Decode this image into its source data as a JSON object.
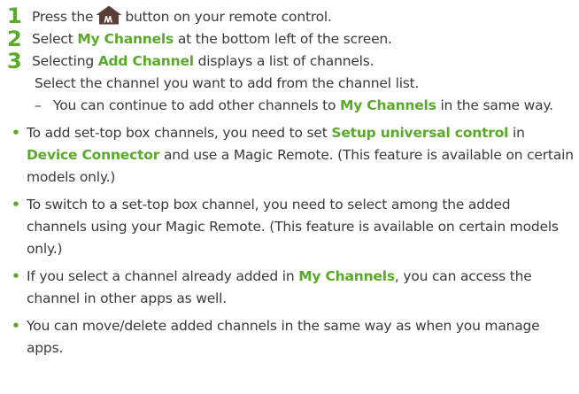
{
  "steps": [
    {
      "number": "1",
      "before": "Press the",
      "icon": "home-icon",
      "after": "button on your remote control."
    },
    {
      "number": "2",
      "before": "Select",
      "highlight": "My Channels",
      "after": "at the bottom left of the screen."
    },
    {
      "number": "3",
      "before": "Selecting",
      "highlight": "Add Channel",
      "after": "displays a list of channels.",
      "line2": "Select the channel you want to add from the channel list.",
      "note": {
        "dash": "–",
        "before": "You can continue to add other channels to",
        "highlight": "My Channels",
        "after": "in the same way."
      }
    }
  ],
  "bullets": [
    {
      "text1": "To add set-top box channels, you need to set",
      "hl1": "Setup universal control",
      "text2": "in",
      "hl2": "Device Connector",
      "text3": "and use a Magic Remote. (This feature is available on certain models only.)"
    },
    {
      "text": "To switch to a set-top box channel, you need to select among the added channels using your Magic Remote. (This feature is available on certain models only.)"
    },
    {
      "text1": "If you select a channel already added in",
      "hl1": "My Channels",
      "text2": ", you can access the channel in other apps as well."
    },
    {
      "text": "You can move/delete added channels in the same way as when you manage apps."
    }
  ],
  "bullet_symbol": "•",
  "colors": {
    "accent": "#5aaa2a",
    "text": "#3a3a3a",
    "icon": "#5a3e33"
  }
}
